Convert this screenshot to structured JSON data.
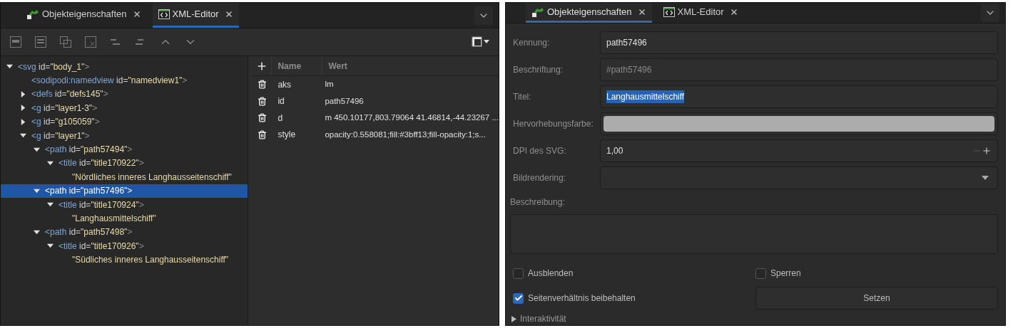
{
  "left_panel": {
    "tabs": [
      {
        "label": "Objekteigenschaften",
        "selected": false
      },
      {
        "label": "XML-Editor",
        "selected": true
      }
    ],
    "tree": [
      {
        "kind": "element",
        "tag": "<svg",
        "attr": "id=",
        "value": "\"body_1\"",
        "close": ">",
        "expanded": true,
        "selected": false,
        "children": [
          {
            "kind": "element",
            "tag": "<sodipodi:namedview",
            "attr": "id=",
            "value": "\"namedview1\"",
            "close": ">",
            "selected": false
          },
          {
            "kind": "element",
            "tag": "<defs",
            "attr": "id=",
            "value": "\"defs145\"",
            "close": ">",
            "expanded": false,
            "selected": false
          },
          {
            "kind": "element",
            "tag": "<g",
            "attr": "id=",
            "value": "\"layer1-3\"",
            "close": ">",
            "expanded": false,
            "selected": false
          },
          {
            "kind": "element",
            "tag": "<g",
            "attr": "id=",
            "value": "\"g105059\"",
            "close": ">",
            "expanded": false,
            "selected": false
          },
          {
            "kind": "element",
            "tag": "<g",
            "attr": "id=",
            "value": "\"layer1\"",
            "close": ">",
            "expanded": true,
            "selected": false,
            "children": [
              {
                "kind": "element",
                "tag": "<path",
                "attr": "id=",
                "value": "\"path57494\"",
                "close": ">",
                "expanded": true,
                "selected": false,
                "children": [
                  {
                    "kind": "element",
                    "tag": "<title",
                    "attr": "id=",
                    "value": "\"title170922\"",
                    "close": ">",
                    "expanded": true,
                    "selected": false,
                    "children": [
                      {
                        "kind": "text",
                        "text": "\"Nördliches inneres Langhausseitenschiff\"",
                        "selected": false
                      }
                    ]
                  }
                ]
              },
              {
                "kind": "element",
                "tag": "<path",
                "attr": "id=",
                "value": "\"path57496\"",
                "close": ">",
                "expanded": true,
                "selected": true,
                "children": [
                  {
                    "kind": "element",
                    "tag": "<title",
                    "attr": "id=",
                    "value": "\"title170924\"",
                    "close": ">",
                    "expanded": true,
                    "selected": false,
                    "children": [
                      {
                        "kind": "text",
                        "text": "\"Langhausmittelschiff\"",
                        "selected": false
                      }
                    ]
                  }
                ]
              },
              {
                "kind": "element",
                "tag": "<path",
                "attr": "id=",
                "value": "\"path57498\"",
                "close": ">",
                "expanded": true,
                "selected": false,
                "children": [
                  {
                    "kind": "element",
                    "tag": "<title",
                    "attr": "id=",
                    "value": "\"title170926\"",
                    "close": ">",
                    "expanded": true,
                    "selected": false,
                    "children": [
                      {
                        "kind": "text",
                        "text": "\"Südliches inneres Langhausseitenschiff\"",
                        "selected": false
                      }
                    ]
                  }
                ]
              }
            ]
          }
        ]
      }
    ],
    "attributes": {
      "columns": [
        "Name",
        "Wert"
      ],
      "rows": [
        {
          "name": "aks",
          "value": "lm"
        },
        {
          "name": "id",
          "value": "path57496"
        },
        {
          "name": "d",
          "value": "m 450.10177,803.79064 41.46814,-44.23267 ..."
        },
        {
          "name": "style",
          "value": "opacity:0.558081;fill:#3bff13;fill-opacity:1;s..."
        }
      ]
    }
  },
  "right_panel": {
    "tabs": [
      {
        "label": "Objekteigenschaften",
        "selected": true
      },
      {
        "label": "XML-Editor",
        "selected": false
      }
    ],
    "fields": [
      {
        "kind": "text",
        "label": "Kennung:",
        "value": "path57496",
        "text_selected": false
      },
      {
        "kind": "placeholder",
        "label": "Beschriftung:",
        "placeholder": "#path57496"
      },
      {
        "kind": "text",
        "label": "Titel:",
        "value": "Langhausmittelschiff",
        "text_selected": true
      },
      {
        "kind": "color",
        "label": "Hervorhebungsfarbe:",
        "color": "#acacac"
      },
      {
        "kind": "spin",
        "label": "DPI des SVG:",
        "value": "1,00"
      },
      {
        "kind": "dropdown",
        "label": "Bildrendering:"
      }
    ],
    "description": {
      "label": "Beschreibung:"
    },
    "checkboxes": [
      {
        "label": "Ausblenden",
        "checked": false
      },
      {
        "label": "Sperren",
        "checked": false
      },
      {
        "label": "Seitenverhältnis beibehalten",
        "checked": true
      }
    ],
    "set_button": "Setzen",
    "expander": {
      "label": "Interaktivität",
      "expanded": false
    }
  }
}
